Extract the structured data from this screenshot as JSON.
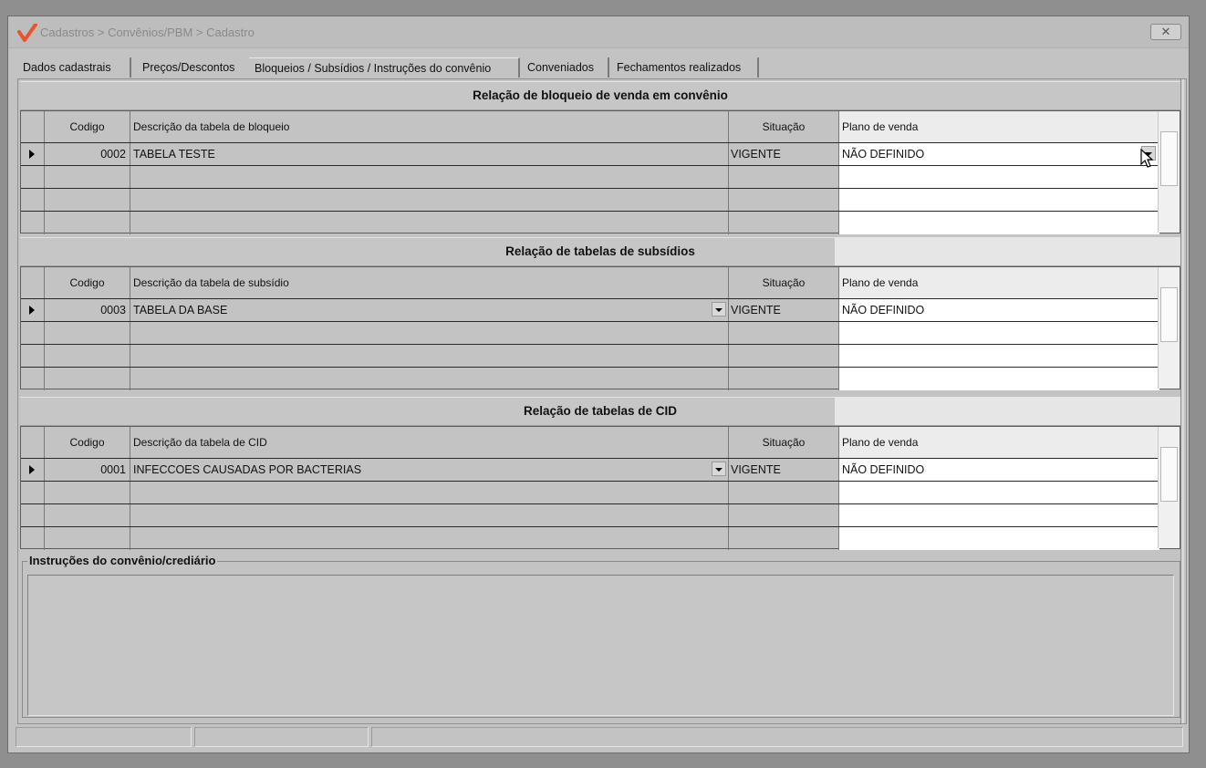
{
  "window": {
    "title": "Cadastros > Convênios/PBM > Cadastro",
    "close_label": "✕"
  },
  "tabs": [
    {
      "label": "Dados cadastrais",
      "active": false
    },
    {
      "label": "Preços/Descontos",
      "active": false
    },
    {
      "label": "Bloqueios / Subsídios / Instruções do convênio",
      "active": true
    },
    {
      "label": "Conveniados",
      "active": false
    },
    {
      "label": "Fechamentos realizados",
      "active": false
    }
  ],
  "sections": [
    {
      "title": "Relação de bloqueio de venda em convênio",
      "columns": [
        "Codigo",
        "Descrição da tabela de bloqueio",
        "Situação",
        "Plano de venda"
      ],
      "rows": [
        {
          "codigo": "0002",
          "descricao": "TABELA TESTE",
          "situacao": "VIGENTE",
          "plano": "NÃO DEFINIDO"
        }
      ]
    },
    {
      "title": "Relação de tabelas de subsídios",
      "columns": [
        "Codigo",
        "Descrição da tabela de subsídio",
        "Situação",
        "Plano de venda"
      ],
      "rows": [
        {
          "codigo": "0003",
          "descricao": "TABELA DA BASE",
          "situacao": "VIGENTE",
          "plano": "NÃO DEFINIDO"
        }
      ]
    },
    {
      "title": "Relação de tabelas de CID",
      "columns": [
        "Codigo",
        "Descrição da tabela de CID",
        "Situação",
        "Plano de venda"
      ],
      "rows": [
        {
          "codigo": "0001",
          "descricao": "INFECCOES CAUSADAS POR BACTERIAS",
          "situacao": "VIGENTE",
          "plano": "NÃO DEFINIDO"
        }
      ]
    }
  ],
  "instructions": {
    "label": "Instruções do convênio/crediário",
    "value": ""
  },
  "colors": {
    "window_bg": "#c3c3c3",
    "logo": "#e8542b"
  }
}
